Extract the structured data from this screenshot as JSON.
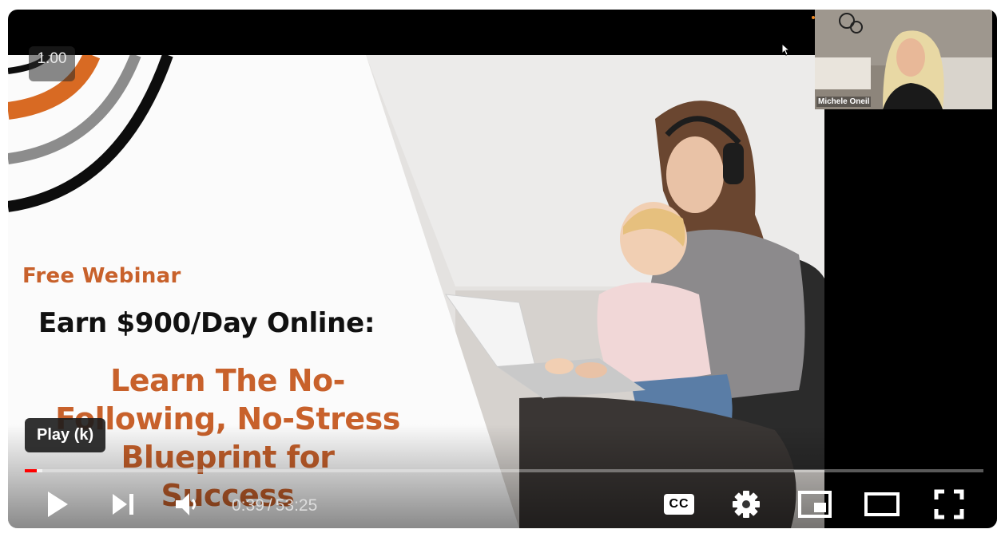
{
  "player": {
    "playback_speed": "1.00",
    "tooltip": "Play (k)",
    "current_time": "0:39",
    "time_separator": "/",
    "duration": "53:25",
    "progress_fraction": 0.0122,
    "buffered_fraction": 0.018,
    "accent_color": "#ff0000",
    "controls": [
      "play-icon",
      "next-icon",
      "volume-icon",
      "cc-icon",
      "gear-icon",
      "miniplayer-icon",
      "theater-mode-icon",
      "fullscreen-icon"
    ],
    "cc_label": "CC"
  },
  "slide": {
    "eyebrow": "Free Webinar",
    "headline": "Earn $900/Day Online:",
    "subhead_lines": [
      "Learn The No-",
      "Following, No-Stress",
      "Blueprint for",
      "Success"
    ],
    "accent_color": "#c8612b"
  },
  "camera": {
    "participant_name": "Michele Oneil"
  }
}
